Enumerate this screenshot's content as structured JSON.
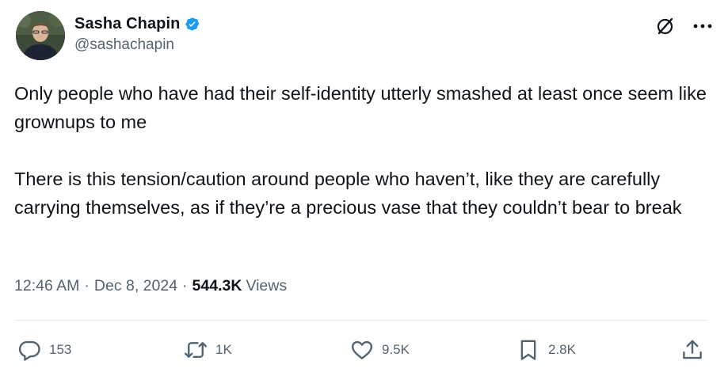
{
  "author": {
    "display_name": "Sasha Chapin",
    "handle": "@sashachapin",
    "verified": true,
    "verified_color": "#1d9bf0"
  },
  "tweet": {
    "paragraphs": [
      "Only people who have had their self-identity utterly smashed at least once seem like grownups to me",
      "There is this tension/caution around people who haven’t, like they are carefully carrying themselves, as if they’re a precious vase that they couldn’t bear to break"
    ],
    "time": "12:46 AM",
    "date": "Dec 8, 2024",
    "views_count": "544.3K",
    "views_label": "Views",
    "separator": "·"
  },
  "actions": {
    "reply_count": "153",
    "repost_count": "1K",
    "like_count": "9.5K",
    "bookmark_count": "2.8K"
  },
  "icons": {
    "verified": "verified-badge-icon",
    "grok": "grok-icon",
    "more": "more-options-icon",
    "reply": "reply-icon",
    "repost": "repost-icon",
    "like": "heart-icon",
    "bookmark": "bookmark-icon",
    "share": "share-icon"
  },
  "colors": {
    "text_primary": "#0f1419",
    "text_secondary": "#536471",
    "divider": "#e8ecef"
  }
}
